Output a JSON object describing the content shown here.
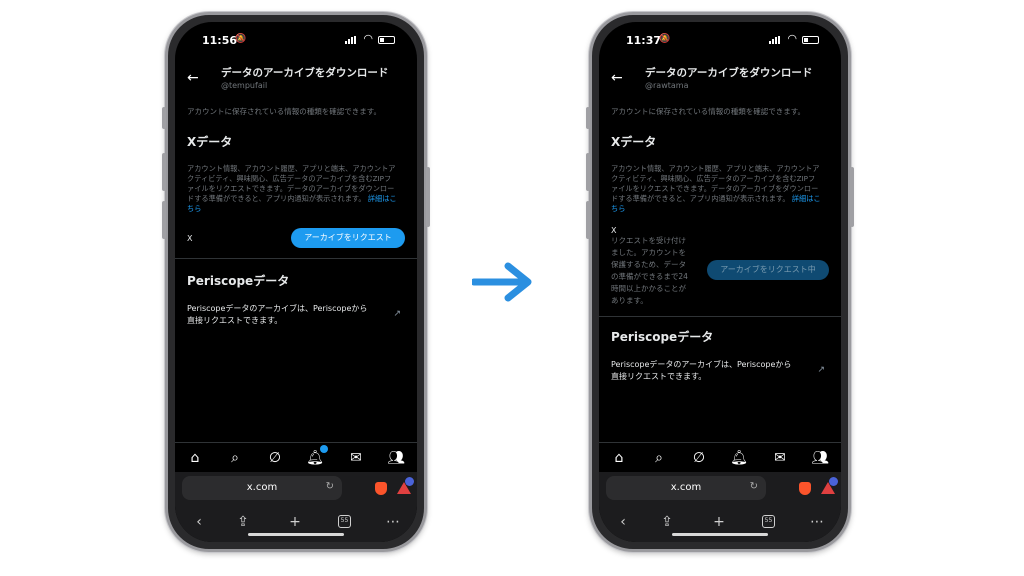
{
  "colors": {
    "accent": "#1d9bf0",
    "arrow": "#2b8fe0",
    "screen_bg": "#000000"
  },
  "before": {
    "status": {
      "time": "11:56"
    },
    "header": {
      "title": "データのアーカイブをダウンロード",
      "handle": "@tempufail"
    },
    "description": "アカウントに保存されている情報の種類を確認できます。",
    "x_section": {
      "title": "Xデータ",
      "body_lines": [
        "アカウント情報、アカウント履歴、アプリと端末、アカウントア",
        "クティビティ、興味関心、広告データのアーカイブを含むZIPフ",
        "ァイルをリクエストできます。データのアーカイブをダウンロー",
        "ドする準備ができると、アプリ内通知が表示されます。"
      ],
      "link_part1": "詳細はこ",
      "link_part2": "ちら",
      "row_label": "X",
      "button_label": "アーカイブをリクエスト"
    },
    "periscope": {
      "title": "Periscopeデータ",
      "line1": "Periscopeデータのアーカイブは、Periscopeから",
      "line2": "直接リクエストできます。"
    },
    "browser": {
      "url": "x.com",
      "tabs_count": "55"
    }
  },
  "after": {
    "status": {
      "time": "11:37"
    },
    "header": {
      "title": "データのアーカイブをダウンロード",
      "handle": "@rawtama"
    },
    "description": "アカウントに保存されている情報の種類を確認できます。",
    "x_section": {
      "title": "Xデータ",
      "body_lines": [
        "アカウント情報、アカウント履歴、アプリと端末、アカウントア",
        "クティビティ、興味関心、広告データのアーカイブを含むZIPフ",
        "ァイルをリクエストできます。データのアーカイブをダウンロー",
        "ドする準備ができると、アプリ内通知が表示されます。"
      ],
      "link_part1": "詳細はこ",
      "link_part2": "ちら",
      "row_label": "X",
      "notice_lines": [
        "リクエストを受け付け",
        "ました。アカウントを",
        "保護するため、データ",
        "の準備ができるまで24",
        "時間以上かかることが",
        "あります。"
      ],
      "button_label": "アーカイブをリクエスト中"
    },
    "periscope": {
      "title": "Periscopeデータ",
      "line1": "Periscopeデータのアーカイブは、Periscopeから",
      "line2": "直接リクエストできます。"
    },
    "browser": {
      "url": "x.com",
      "tabs_count": "55"
    }
  },
  "icons": {
    "tabbar": [
      "home-icon",
      "search-icon",
      "grok-icon",
      "notifications-icon",
      "messages-icon",
      "communities-icon"
    ],
    "browser": [
      "back-icon",
      "share-icon",
      "add-tab-icon",
      "tabs-icon",
      "more-icon"
    ]
  }
}
